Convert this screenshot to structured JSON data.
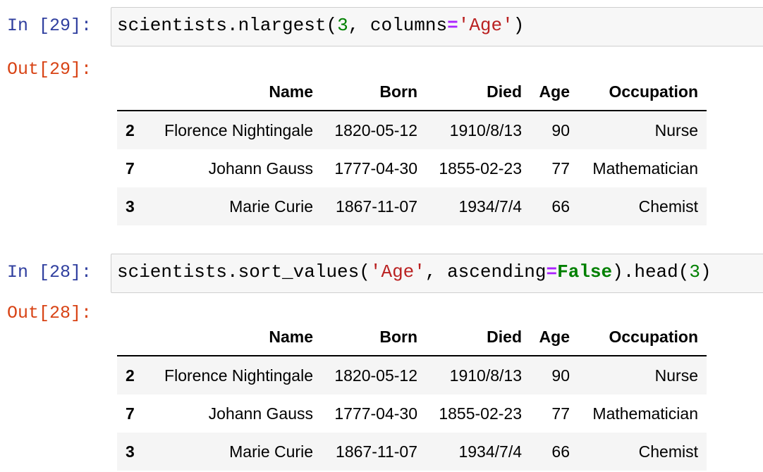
{
  "cells": [
    {
      "in_prompt": "In [29]:",
      "out_prompt": "Out[29]:",
      "code": {
        "t1": "scientists.nlargest(",
        "t2": "3",
        "t3": ", columns",
        "t4": "=",
        "t5": "'Age'",
        "t6": ")"
      },
      "table": {
        "columns": [
          "Name",
          "Born",
          "Died",
          "Age",
          "Occupation"
        ],
        "rows": [
          {
            "index": "2",
            "Name": "Florence Nightingale",
            "Born": "1820-05-12",
            "Died": "1910/8/13",
            "Age": "90",
            "Occupation": "Nurse"
          },
          {
            "index": "7",
            "Name": "Johann Gauss",
            "Born": "1777-04-30",
            "Died": "1855-02-23",
            "Age": "77",
            "Occupation": "Mathematician"
          },
          {
            "index": "3",
            "Name": "Marie Curie",
            "Born": "1867-11-07",
            "Died": "1934/7/4",
            "Age": "66",
            "Occupation": "Chemist"
          }
        ]
      }
    },
    {
      "in_prompt": "In [28]:",
      "out_prompt": "Out[28]:",
      "code": {
        "t1": "scientists.sort_values(",
        "t2": "'Age'",
        "t3": ", ascending",
        "t4": "=",
        "t5": "False",
        "t6": ").head(",
        "t7": "3",
        "t8": ")"
      },
      "table": {
        "columns": [
          "Name",
          "Born",
          "Died",
          "Age",
          "Occupation"
        ],
        "rows": [
          {
            "index": "2",
            "Name": "Florence Nightingale",
            "Born": "1820-05-12",
            "Died": "1910/8/13",
            "Age": "90",
            "Occupation": "Nurse"
          },
          {
            "index": "7",
            "Name": "Johann Gauss",
            "Born": "1777-04-30",
            "Died": "1855-02-23",
            "Age": "77",
            "Occupation": "Mathematician"
          },
          {
            "index": "3",
            "Name": "Marie Curie",
            "Born": "1867-11-07",
            "Died": "1934/7/4",
            "Age": "66",
            "Occupation": "Chemist"
          }
        ]
      }
    }
  ]
}
